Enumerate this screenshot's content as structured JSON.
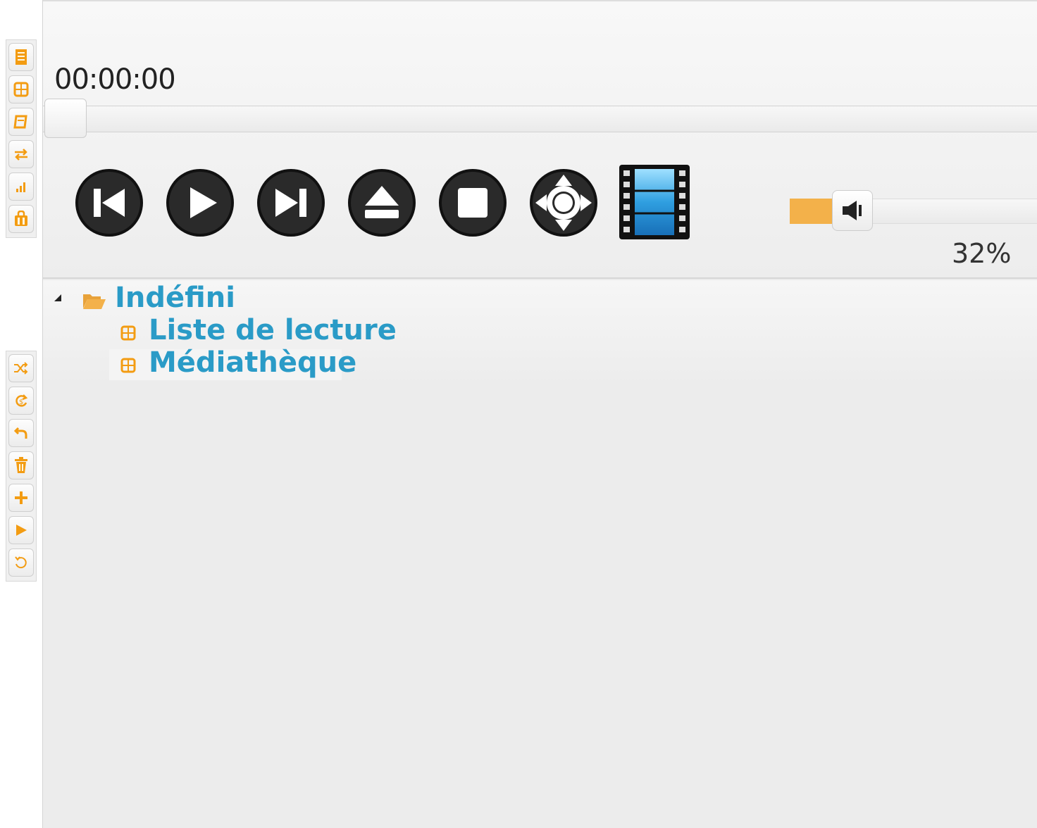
{
  "colors": {
    "accent_orange": "#f39c12",
    "tree_text_blue": "#2a9bc7",
    "volume_fill": "#f3b14a"
  },
  "top_toolbar": {
    "icons": [
      "document-icon",
      "grid-icon",
      "playlist-icon",
      "repeat-arrows-icon",
      "signal-bars-icon",
      "bag-icon"
    ]
  },
  "bottom_toolbar": {
    "icons": [
      "shuffle-icon",
      "loop-icon",
      "undo-icon",
      "trash-icon",
      "add-icon",
      "play-small-icon",
      "refresh-icon"
    ]
  },
  "player": {
    "time": "00:00:00",
    "seek_progress": 0,
    "controls": [
      "previous-icon",
      "play-icon",
      "next-icon",
      "eject-icon",
      "stop-icon",
      "fullscreen-icon",
      "video-film-icon"
    ],
    "volume": {
      "percent_label": "32%",
      "level": 0.32
    }
  },
  "tree": {
    "root": "Indéfini",
    "children": [
      "Liste de lecture",
      "Médiathèque"
    ]
  }
}
